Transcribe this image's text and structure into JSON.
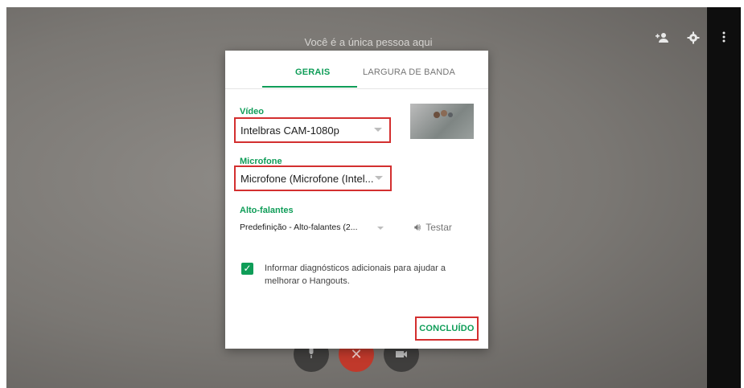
{
  "call": {
    "empty_message": "Você é a única pessoa aqui"
  },
  "toolbar": {
    "icons": [
      "add-person-icon",
      "gear-icon",
      "more-vert-icon"
    ]
  },
  "dialog": {
    "tabs": [
      {
        "label": "GERAIS",
        "active": true
      },
      {
        "label": "LARGURA DE BANDA",
        "active": false
      }
    ],
    "video": {
      "label": "Vídeo",
      "selected": "Intelbras CAM-1080p"
    },
    "microphone": {
      "label": "Microfone",
      "selected": "Microfone (Microfone (Intel..."
    },
    "speakers": {
      "label": "Alto-falantes",
      "selected": "Predefinição - Alto-falantes (2...",
      "test_label": "Testar"
    },
    "diagnostics": {
      "checked": true,
      "text": "Informar diagnósticos adicionais para ajudar a melhorar o Hangouts."
    },
    "done_label": "CONCLUÍDO"
  },
  "colors": {
    "accent": "#0f9d58",
    "highlight": "#d32f2f",
    "end_call": "#c0392b"
  }
}
